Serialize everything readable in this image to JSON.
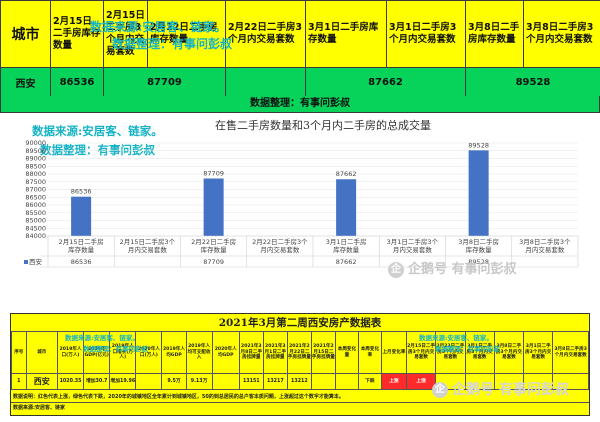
{
  "top_table": {
    "headers": {
      "city": "城市",
      "c1": "2月15日二手房库存数量",
      "c2": "2月15日二手房3个月内交易套数",
      "c3": "2月22日二手房库存数量",
      "c4": "2月22日二手房3个月内交易套数",
      "c5": "3月1日二手房库存数量",
      "c6": "3月1日二手房3个月内交易套数",
      "c7": "3月8日二手房库存数量",
      "c8": "3月8日二手房3个月内交易套数"
    },
    "row": {
      "city": "西安",
      "v1": "86536",
      "v3": "87709",
      "v5": "87662",
      "v7": "89528"
    },
    "watermark_source": "数据来源:安居客、链家。",
    "watermark_author": "数据整理：有事问彭叔"
  },
  "banner": "数据整理：有事问彭叔",
  "chart_data": {
    "type": "bar",
    "title": "在售二手房数量和3个月内二手房的总成交量",
    "categories": [
      "2月15日二手房库存数量",
      "2月15日二手房3个月内交易套数",
      "2月22日二手房库存数量",
      "2月22日二手房3个月内交易套数",
      "3月1日二手房库存数量",
      "3月1日二手房3个月内交易套数",
      "3月8日二手房库存数量",
      "3月8日二手房3个月内交易套数"
    ],
    "series": [
      {
        "name": "西安",
        "values": [
          86536,
          null,
          87709,
          null,
          87662,
          null,
          89528,
          null
        ]
      }
    ],
    "ylim": [
      84000,
      90000
    ],
    "yticks": [
      84000,
      84500,
      85000,
      85500,
      86000,
      86500,
      87000,
      87500,
      88000,
      88500,
      89000,
      89500,
      90000
    ],
    "legend": "bottom-left data table",
    "color": "#4472c4",
    "watermark_source": "数据来源:安居客、链家。",
    "watermark_author": "数据整理：有事问彭叔"
  },
  "brand_watermark": "企鹅号 有事问彭叔",
  "brand_watermark_2": "企鹅号 有事问彭叔",
  "bottom_table": {
    "title": "2021年3月第二周西安房产数据表",
    "headers": [
      "序号",
      "城市",
      "2019年人口(万人)",
      "2019年GDP(亿元)",
      "2019年人口增长(万人)",
      "2020年人口(万人)",
      "2019年人均GDP",
      "2019年人均可支配收入",
      "2020年人均GDP",
      "2021年3月8日二手房挂牌量",
      "2021年3月1日二手房挂牌量",
      "2021年2月22日二手房挂牌量",
      "2021年2月15日二手房挂牌量",
      "本周变化量",
      "本周变化率",
      "上月变化率",
      "2月15日二手房3个月内交易套数",
      "2月22日二手房3个月内交易套数",
      "3月1日二手房3个月内交易套数",
      "3月8日二手房3个月内交易套数",
      "3月1日二手房3个月内交易套数",
      "3月8日二手房3个月内交易套数"
    ],
    "row": [
      "1",
      "西安",
      "1020.35",
      "增加30.7",
      "增加19.96",
      "",
      "9.5万",
      "9.13万",
      "",
      "13151",
      "13217",
      "13212",
      "",
      "",
      "下跌",
      "上涨",
      "上涨",
      "",
      "",
      "",
      "",
      ""
    ],
    "watermark_source": "数据来源:安居客、链家。",
    "watermark_author": "数据整理：有事问彭叔",
    "note1": "数据说明：红色代表上涨，绿色代表下跌，2020年的城镇地区全年累计到城镇地区，50的到总居民的总户客本质问题，上涨超过这个数字才能算本。",
    "note2": "数据来源:安居客、链家"
  }
}
